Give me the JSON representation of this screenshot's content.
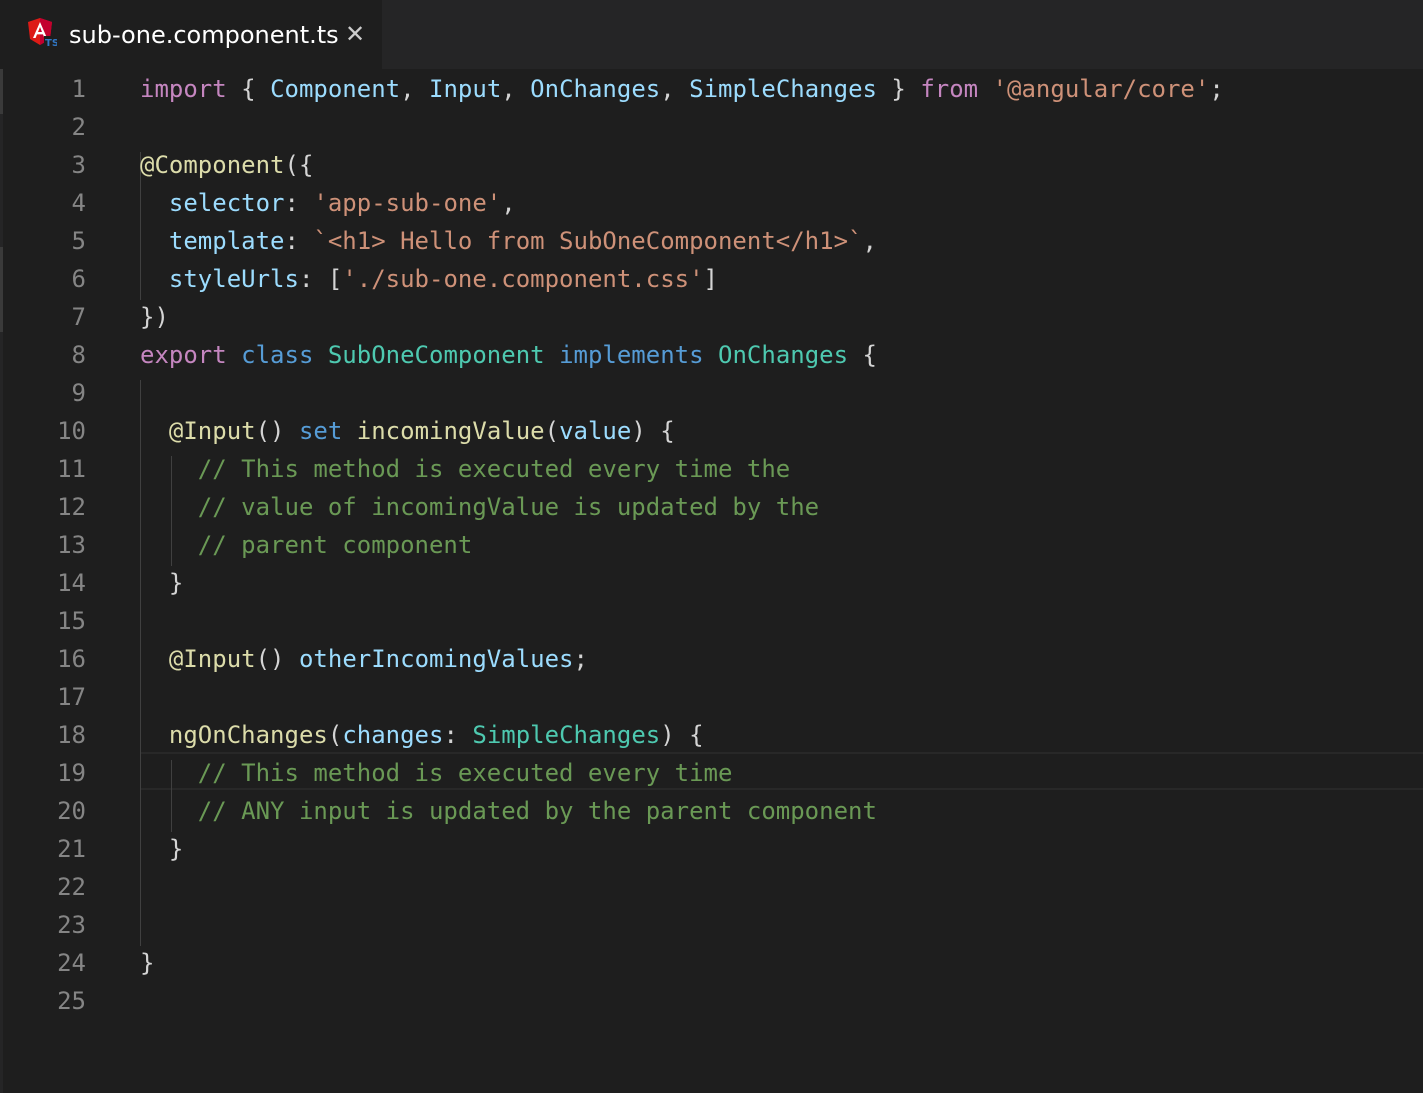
{
  "tab": {
    "filename": "sub-one.component.ts",
    "close_glyph": "✕",
    "icon": "angular-typescript-file-icon"
  },
  "theme": {
    "background": "#1e1e1e",
    "keyword": "#c586c0",
    "storage": "#569cd6",
    "type": "#4ec9b0",
    "variable": "#9cdcfe",
    "string": "#ce9178",
    "function": "#dcdcaa",
    "comment": "#6a9955",
    "line_number": "#858585"
  },
  "editor": {
    "current_line": 19,
    "lines": [
      {
        "n": "1",
        "tokens": [
          [
            "import",
            "kw"
          ],
          [
            " { ",
            "pn"
          ],
          [
            "Component",
            "var"
          ],
          [
            ", ",
            "pn"
          ],
          [
            "Input",
            "var"
          ],
          [
            ", ",
            "pn"
          ],
          [
            "OnChanges",
            "var"
          ],
          [
            ", ",
            "pn"
          ],
          [
            "SimpleChanges",
            "var"
          ],
          [
            " } ",
            "pn"
          ],
          [
            "from",
            "kw"
          ],
          [
            " ",
            "pn"
          ],
          [
            "'@angular/core'",
            "str"
          ],
          [
            ";",
            "pn"
          ]
        ]
      },
      {
        "n": "2",
        "tokens": []
      },
      {
        "n": "3",
        "tokens": [
          [
            "@Component",
            "fn"
          ],
          [
            "({",
            "pn"
          ]
        ]
      },
      {
        "n": "4",
        "tokens": [
          [
            "  ",
            "pn"
          ],
          [
            "selector",
            "var"
          ],
          [
            ": ",
            "pn"
          ],
          [
            "'app-sub-one'",
            "str"
          ],
          [
            ",",
            "pn"
          ]
        ]
      },
      {
        "n": "5",
        "tokens": [
          [
            "  ",
            "pn"
          ],
          [
            "template",
            "var"
          ],
          [
            ": ",
            "pn"
          ],
          [
            "`<h1> Hello from SubOneComponent</h1>`",
            "str"
          ],
          [
            ",",
            "pn"
          ]
        ]
      },
      {
        "n": "6",
        "tokens": [
          [
            "  ",
            "pn"
          ],
          [
            "styleUrls",
            "var"
          ],
          [
            ": [",
            "pn"
          ],
          [
            "'./sub-one.component.css'",
            "str"
          ],
          [
            "]",
            "pn"
          ]
        ]
      },
      {
        "n": "7",
        "tokens": [
          [
            "})",
            "pn"
          ]
        ]
      },
      {
        "n": "8",
        "tokens": [
          [
            "export",
            "kw"
          ],
          [
            " ",
            "pn"
          ],
          [
            "class",
            "kw2"
          ],
          [
            " ",
            "pn"
          ],
          [
            "SubOneComponent",
            "cls"
          ],
          [
            " ",
            "pn"
          ],
          [
            "implements",
            "kw2"
          ],
          [
            " ",
            "pn"
          ],
          [
            "OnChanges",
            "cls"
          ],
          [
            " {",
            "pn"
          ]
        ]
      },
      {
        "n": "9",
        "tokens": []
      },
      {
        "n": "10",
        "tokens": [
          [
            "  ",
            "pn"
          ],
          [
            "@Input",
            "fn"
          ],
          [
            "() ",
            "pn"
          ],
          [
            "set",
            "kw2"
          ],
          [
            " ",
            "pn"
          ],
          [
            "incomingValue",
            "fn"
          ],
          [
            "(",
            "pn"
          ],
          [
            "value",
            "var"
          ],
          [
            ") {",
            "pn"
          ]
        ]
      },
      {
        "n": "11",
        "tokens": [
          [
            "    ",
            "pn"
          ],
          [
            "// This method is executed every time the",
            "cm"
          ]
        ]
      },
      {
        "n": "12",
        "tokens": [
          [
            "    ",
            "pn"
          ],
          [
            "// value of incomingValue is updated by the",
            "cm"
          ]
        ]
      },
      {
        "n": "13",
        "tokens": [
          [
            "    ",
            "pn"
          ],
          [
            "// parent component",
            "cm"
          ]
        ]
      },
      {
        "n": "14",
        "tokens": [
          [
            "  }",
            "pn"
          ]
        ]
      },
      {
        "n": "15",
        "tokens": []
      },
      {
        "n": "16",
        "tokens": [
          [
            "  ",
            "pn"
          ],
          [
            "@Input",
            "fn"
          ],
          [
            "() ",
            "pn"
          ],
          [
            "otherIncomingValues",
            "var"
          ],
          [
            ";",
            "pn"
          ]
        ]
      },
      {
        "n": "17",
        "tokens": []
      },
      {
        "n": "18",
        "tokens": [
          [
            "  ",
            "pn"
          ],
          [
            "ngOnChanges",
            "fn"
          ],
          [
            "(",
            "pn"
          ],
          [
            "changes",
            "var"
          ],
          [
            ": ",
            "pn"
          ],
          [
            "SimpleChanges",
            "cls"
          ],
          [
            ") {",
            "pn"
          ]
        ]
      },
      {
        "n": "19",
        "tokens": [
          [
            "    ",
            "pn"
          ],
          [
            "// This method is executed every time",
            "cm"
          ]
        ]
      },
      {
        "n": "20",
        "tokens": [
          [
            "    ",
            "pn"
          ],
          [
            "// ANY input is updated by the parent component",
            "cm"
          ]
        ]
      },
      {
        "n": "21",
        "tokens": [
          [
            "  }",
            "pn"
          ]
        ]
      },
      {
        "n": "22",
        "tokens": []
      },
      {
        "n": "23",
        "tokens": []
      },
      {
        "n": "24",
        "tokens": [
          [
            "}",
            "pn"
          ]
        ]
      },
      {
        "n": "25",
        "tokens": []
      }
    ]
  }
}
